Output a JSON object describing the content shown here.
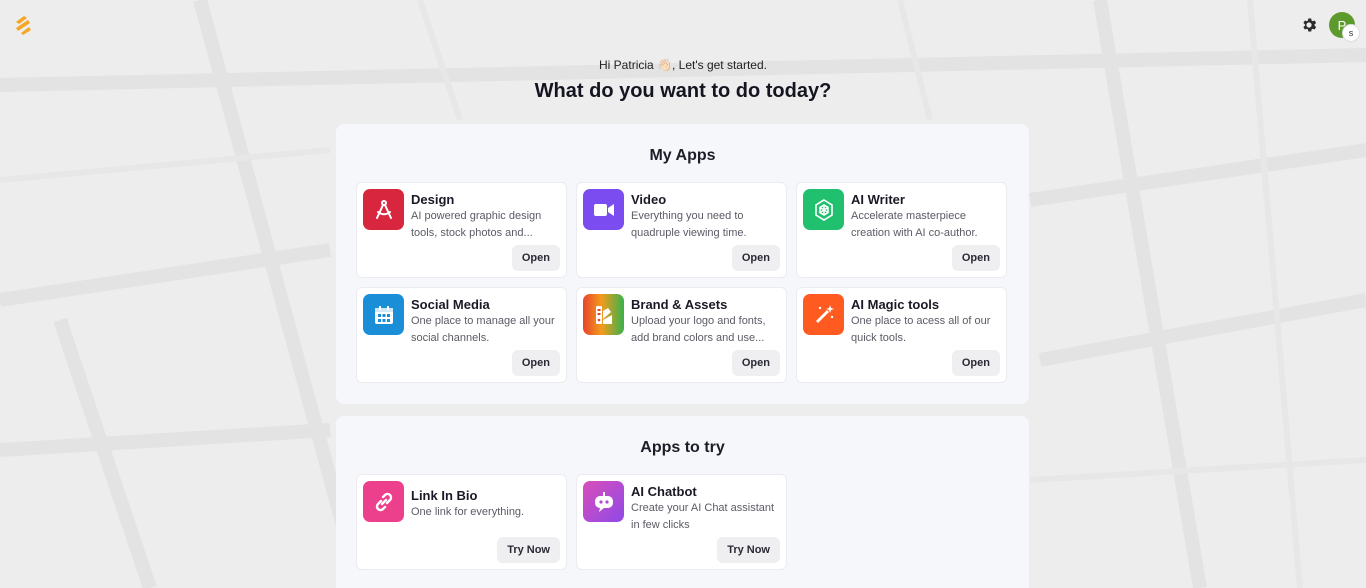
{
  "header": {
    "logo_icon": "brand-logo-icon",
    "settings_icon": "gear-icon",
    "avatar_initial": "P",
    "avatar_badge": "s"
  },
  "greeting": "Hi Patricia 👋🏻, Let's get started.",
  "headline": "What do you want to do today?",
  "my_apps": {
    "title": "My Apps",
    "items": [
      {
        "title": "Design",
        "desc": "AI powered graphic design tools, stock photos and...",
        "button": "Open",
        "icon": "design-compass-icon",
        "color": "#d7263d"
      },
      {
        "title": "Video",
        "desc": "Everything you need to quadruple viewing time.",
        "button": "Open",
        "icon": "video-camera-icon",
        "color": "#7b4df0"
      },
      {
        "title": "AI Writer",
        "desc": "Accelerate masterpiece creation with AI co-author.",
        "button": "Open",
        "icon": "ai-writer-icon",
        "color": "#21c06e"
      },
      {
        "title": "Social Media",
        "desc": "One place to manage all your social channels.",
        "button": "Open",
        "icon": "calendar-icon",
        "color": "#1a8fd8"
      },
      {
        "title": "Brand & Assets",
        "desc": "Upload your logo and fonts, add brand colors and use...",
        "button": "Open",
        "icon": "brand-palette-icon",
        "color": "#e8432d"
      },
      {
        "title": "AI Magic tools",
        "desc": "One place to acess all of our quick tools.",
        "button": "Open",
        "icon": "magic-wand-icon",
        "color": "#ff5a1f"
      }
    ]
  },
  "apps_to_try": {
    "title": "Apps to try",
    "items": [
      {
        "title": "Link In Bio",
        "desc": "One link for everything.",
        "button": "Try Now",
        "icon": "link-icon",
        "color": "#ec3f8c"
      },
      {
        "title": "AI Chatbot",
        "desc": "Create your AI Chat assistant in few clicks",
        "button": "Try Now",
        "icon": "chatbot-icon",
        "color": "#b548d6"
      }
    ]
  }
}
